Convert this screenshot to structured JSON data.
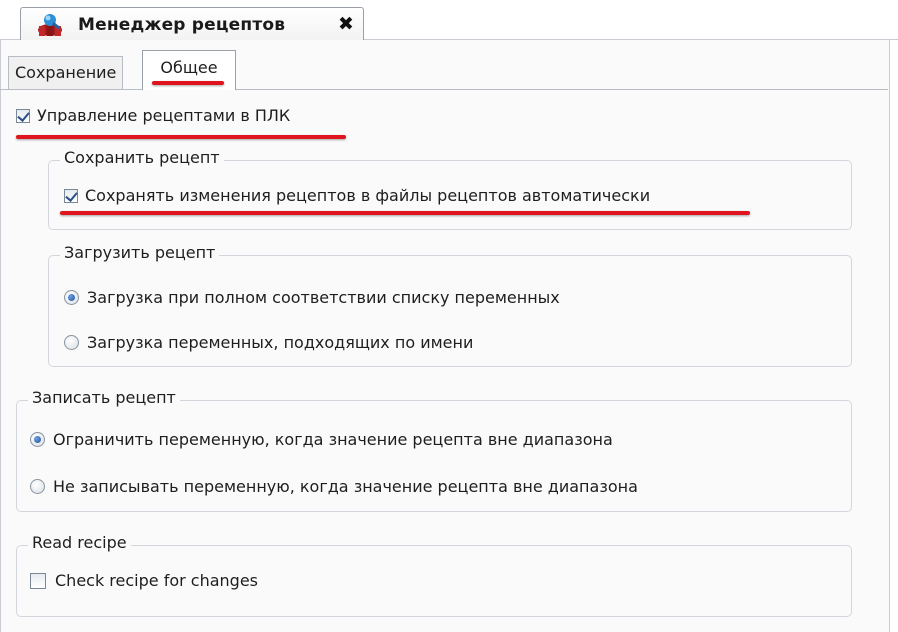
{
  "document_tab": {
    "title": "Менеджер рецептов",
    "close_glyph": "x",
    "icon": "recipe-manager-icon"
  },
  "subtabs": [
    {
      "label": "Сохранение",
      "active": false
    },
    {
      "label": "Общее",
      "active": true
    }
  ],
  "plc_recipe_management": {
    "label": "Управление рецептами в ПЛК",
    "checked": true
  },
  "save_recipe": {
    "title": "Сохранить рецепт",
    "auto_save": {
      "label": "Сохранять изменения рецептов в файлы рецептов автоматически",
      "checked": true
    }
  },
  "load_recipe": {
    "title": "Загрузить рецепт",
    "options": [
      {
        "label": "Загрузка при полном соответствии списку переменных",
        "selected": true
      },
      {
        "label": "Загрузка переменных, подходящих по имени",
        "selected": false
      }
    ]
  },
  "write_recipe": {
    "title": "Записать рецепт",
    "options": [
      {
        "label": "Ограничить переменную, когда значение рецепта вне диапазона",
        "selected": true
      },
      {
        "label": "Не записывать переменную, когда значение рецепта вне диапазона",
        "selected": false
      }
    ]
  },
  "read_recipe": {
    "title": "Read recipe",
    "check_changes": {
      "label": "Check recipe for changes",
      "checked": false
    }
  },
  "colors": {
    "highlight_red": "#e0141e",
    "frame_border": "#c9ccd2",
    "radio_selected": "#1f4f9c"
  }
}
